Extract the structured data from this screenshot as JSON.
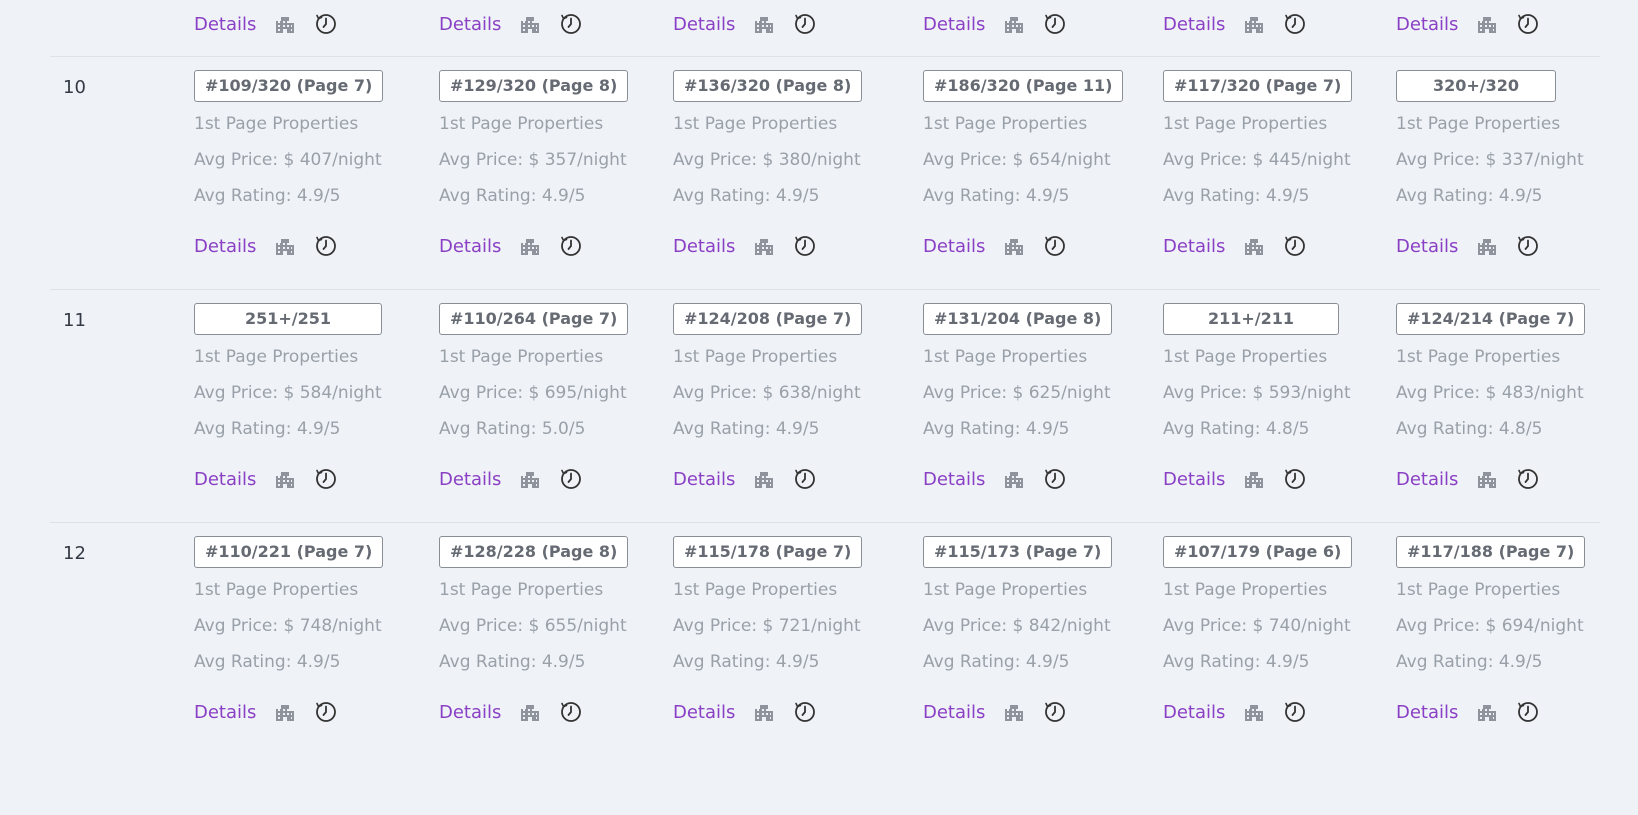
{
  "common": {
    "details_label": "Details",
    "properties_label": "1st Page Properties",
    "icons": {
      "properties": "buildings-icon",
      "history": "history-clock-icon"
    },
    "colors": {
      "link": "#8a3fc4",
      "muted_text": "#9aa0a8",
      "badge_text": "#666b73",
      "background": "#eff3f8"
    }
  },
  "rows": [
    {
      "num": "10",
      "cells": [
        {
          "rank": "#109/320 (Page 7)",
          "price": "Avg Price: $ 407/night",
          "rating": "Avg Rating: 4.9/5"
        },
        {
          "rank": "#129/320 (Page 8)",
          "price": "Avg Price: $ 357/night",
          "rating": "Avg Rating: 4.9/5"
        },
        {
          "rank": "#136/320 (Page 8)",
          "price": "Avg Price: $ 380/night",
          "rating": "Avg Rating: 4.9/5"
        },
        {
          "rank": "#186/320 (Page 11)",
          "price": "Avg Price: $ 654/night",
          "rating": "Avg Rating: 4.9/5"
        },
        {
          "rank": "#117/320 (Page 7)",
          "price": "Avg Price: $ 445/night",
          "rating": "Avg Rating: 4.9/5"
        },
        {
          "rank": "320+/320",
          "price": "Avg Price: $ 337/night",
          "rating": "Avg Rating: 4.9/5"
        }
      ]
    },
    {
      "num": "11",
      "cells": [
        {
          "rank": "251+/251",
          "price": "Avg Price: $ 584/night",
          "rating": "Avg Rating: 4.9/5"
        },
        {
          "rank": "#110/264 (Page 7)",
          "price": "Avg Price: $ 695/night",
          "rating": "Avg Rating: 5.0/5"
        },
        {
          "rank": "#124/208 (Page 7)",
          "price": "Avg Price: $ 638/night",
          "rating": "Avg Rating: 4.9/5"
        },
        {
          "rank": "#131/204 (Page 8)",
          "price": "Avg Price: $ 625/night",
          "rating": "Avg Rating: 4.9/5"
        },
        {
          "rank": "211+/211",
          "price": "Avg Price: $ 593/night",
          "rating": "Avg Rating: 4.8/5"
        },
        {
          "rank": "#124/214 (Page 7)",
          "price": "Avg Price: $ 483/night",
          "rating": "Avg Rating: 4.8/5"
        }
      ]
    },
    {
      "num": "12",
      "cells": [
        {
          "rank": "#110/221 (Page 7)",
          "price": "Avg Price: $ 748/night",
          "rating": "Avg Rating: 4.9/5"
        },
        {
          "rank": "#128/228 (Page 8)",
          "price": "Avg Price: $ 655/night",
          "rating": "Avg Rating: 4.9/5"
        },
        {
          "rank": "#115/178 (Page 7)",
          "price": "Avg Price: $ 721/night",
          "rating": "Avg Rating: 4.9/5"
        },
        {
          "rank": "#115/173 (Page 7)",
          "price": "Avg Price: $ 842/night",
          "rating": "Avg Rating: 4.9/5"
        },
        {
          "rank": "#107/179 (Page 6)",
          "price": "Avg Price: $ 740/night",
          "rating": "Avg Rating: 4.9/5"
        },
        {
          "rank": "#117/188 (Page 7)",
          "price": "Avg Price: $ 694/night",
          "rating": "Avg Rating: 4.9/5"
        }
      ]
    }
  ]
}
